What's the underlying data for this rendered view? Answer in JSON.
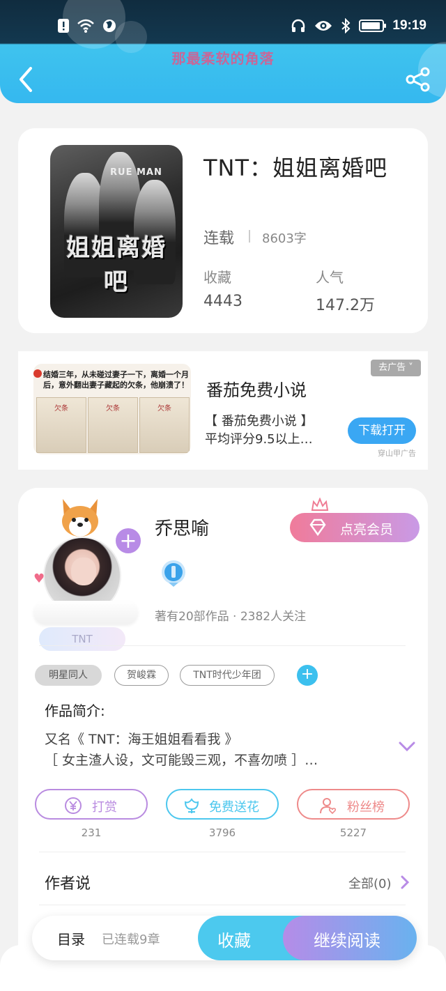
{
  "status_bar": {
    "time": "19:19",
    "battery_level": 0.9
  },
  "header": {
    "title": "那最柔软的角落"
  },
  "book": {
    "title": "TNT：姐姐离婚吧",
    "cover_text": "姐姐离婚吧",
    "cover_en": "RUE MAN",
    "status": "连载",
    "word_count": "8603字",
    "favorites_label": "收藏",
    "favorites_value": "4443",
    "popularity_label": "人气",
    "popularity_value": "147.2万"
  },
  "ad": {
    "image_headline": "结婚三年，从未碰过妻子一下，离婚一个月后，意外翻出妻子藏起的欠条，他崩溃了！",
    "paper_label": "欠条",
    "title": "番茄免费小说",
    "desc_line1": "【 番茄免费小说 】",
    "desc_line2": "平均评分9.5以上…",
    "close_label": "去广告 ˅",
    "cta_label": "下载打开",
    "source": "穿山甲广告"
  },
  "author": {
    "name": "乔思喻",
    "meta": "著有20部作品 · 2382人关注",
    "avatar_tag": "TNT",
    "vip_label": "点亮会员",
    "plus": "+"
  },
  "tags": {
    "main": "明星同人",
    "items": [
      "贺峻霖",
      "TNT时代少年团"
    ],
    "add": "+"
  },
  "intro": {
    "title": "作品简介:",
    "line1": "又名《 TNT：海王姐姐看看我 》",
    "line2": "［ 女主渣人设，文可能毁三观，不喜勿喷 ］…"
  },
  "actions": [
    {
      "label": "打赏",
      "count": "231",
      "color": "#b98be0"
    },
    {
      "label": "免费送花",
      "count": "3796",
      "color": "#4cc7ee"
    },
    {
      "label": "粉丝榜",
      "count": "5227",
      "color": "#ee8a8a"
    }
  ],
  "author_says": {
    "title": "作者说",
    "all_label": "全部(0)"
  },
  "bottom_bar": {
    "toc_label": "目录",
    "chapters": "已连载9章",
    "collect_label": "收藏",
    "read_label": "继续阅读"
  }
}
